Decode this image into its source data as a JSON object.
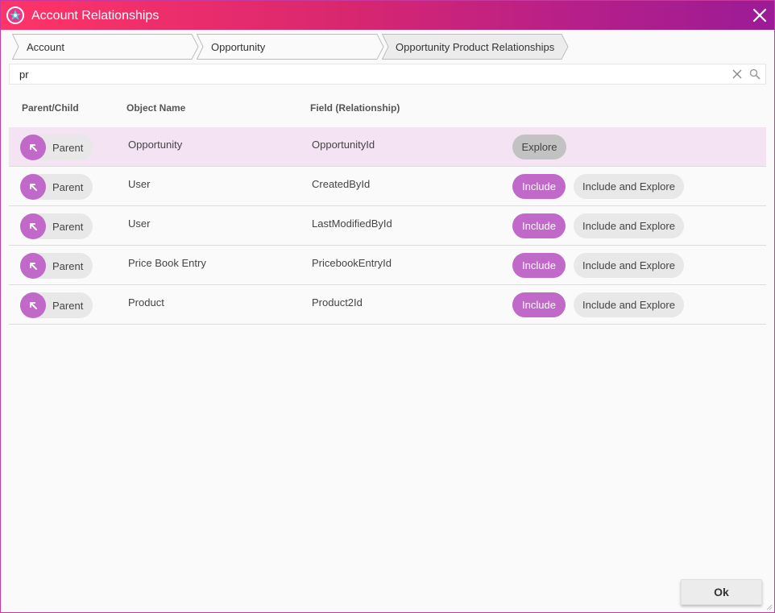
{
  "window": {
    "title": "Account Relationships",
    "accent_color": "#c069c9",
    "titlebar_gradient": [
      "#ff3468",
      "#9c1b96"
    ]
  },
  "breadcrumb": [
    "Account",
    "Opportunity",
    "Opportunity Product Relationships"
  ],
  "search": {
    "value": "pr",
    "placeholder": ""
  },
  "table": {
    "headers": [
      "Parent/Child",
      "Object Name",
      "Field (Relationship)"
    ],
    "rows": [
      {
        "kind": "Parent",
        "object": "Opportunity",
        "field": "OpportunityId",
        "action": "Explore"
      },
      {
        "kind": "Parent",
        "object": "User",
        "field": "CreatedById",
        "include": "Include",
        "include_explore": "Include and Explore"
      },
      {
        "kind": "Parent",
        "object": "User",
        "field": "LastModifiedById",
        "include": "Include",
        "include_explore": "Include and Explore"
      },
      {
        "kind": "Parent",
        "object": "Price Book Entry",
        "field": "PricebookEntryId",
        "include": "Include",
        "include_explore": "Include and Explore"
      },
      {
        "kind": "Parent",
        "object": "Product",
        "field": "Product2Id",
        "include": "Include",
        "include_explore": "Include and Explore"
      }
    ]
  },
  "footer": {
    "ok_label": "Ok"
  },
  "icons": {
    "app": "app-logo-icon",
    "close": "close-icon",
    "clear": "clear-icon",
    "search": "search-icon",
    "parent": "arrow-up-left-icon"
  }
}
